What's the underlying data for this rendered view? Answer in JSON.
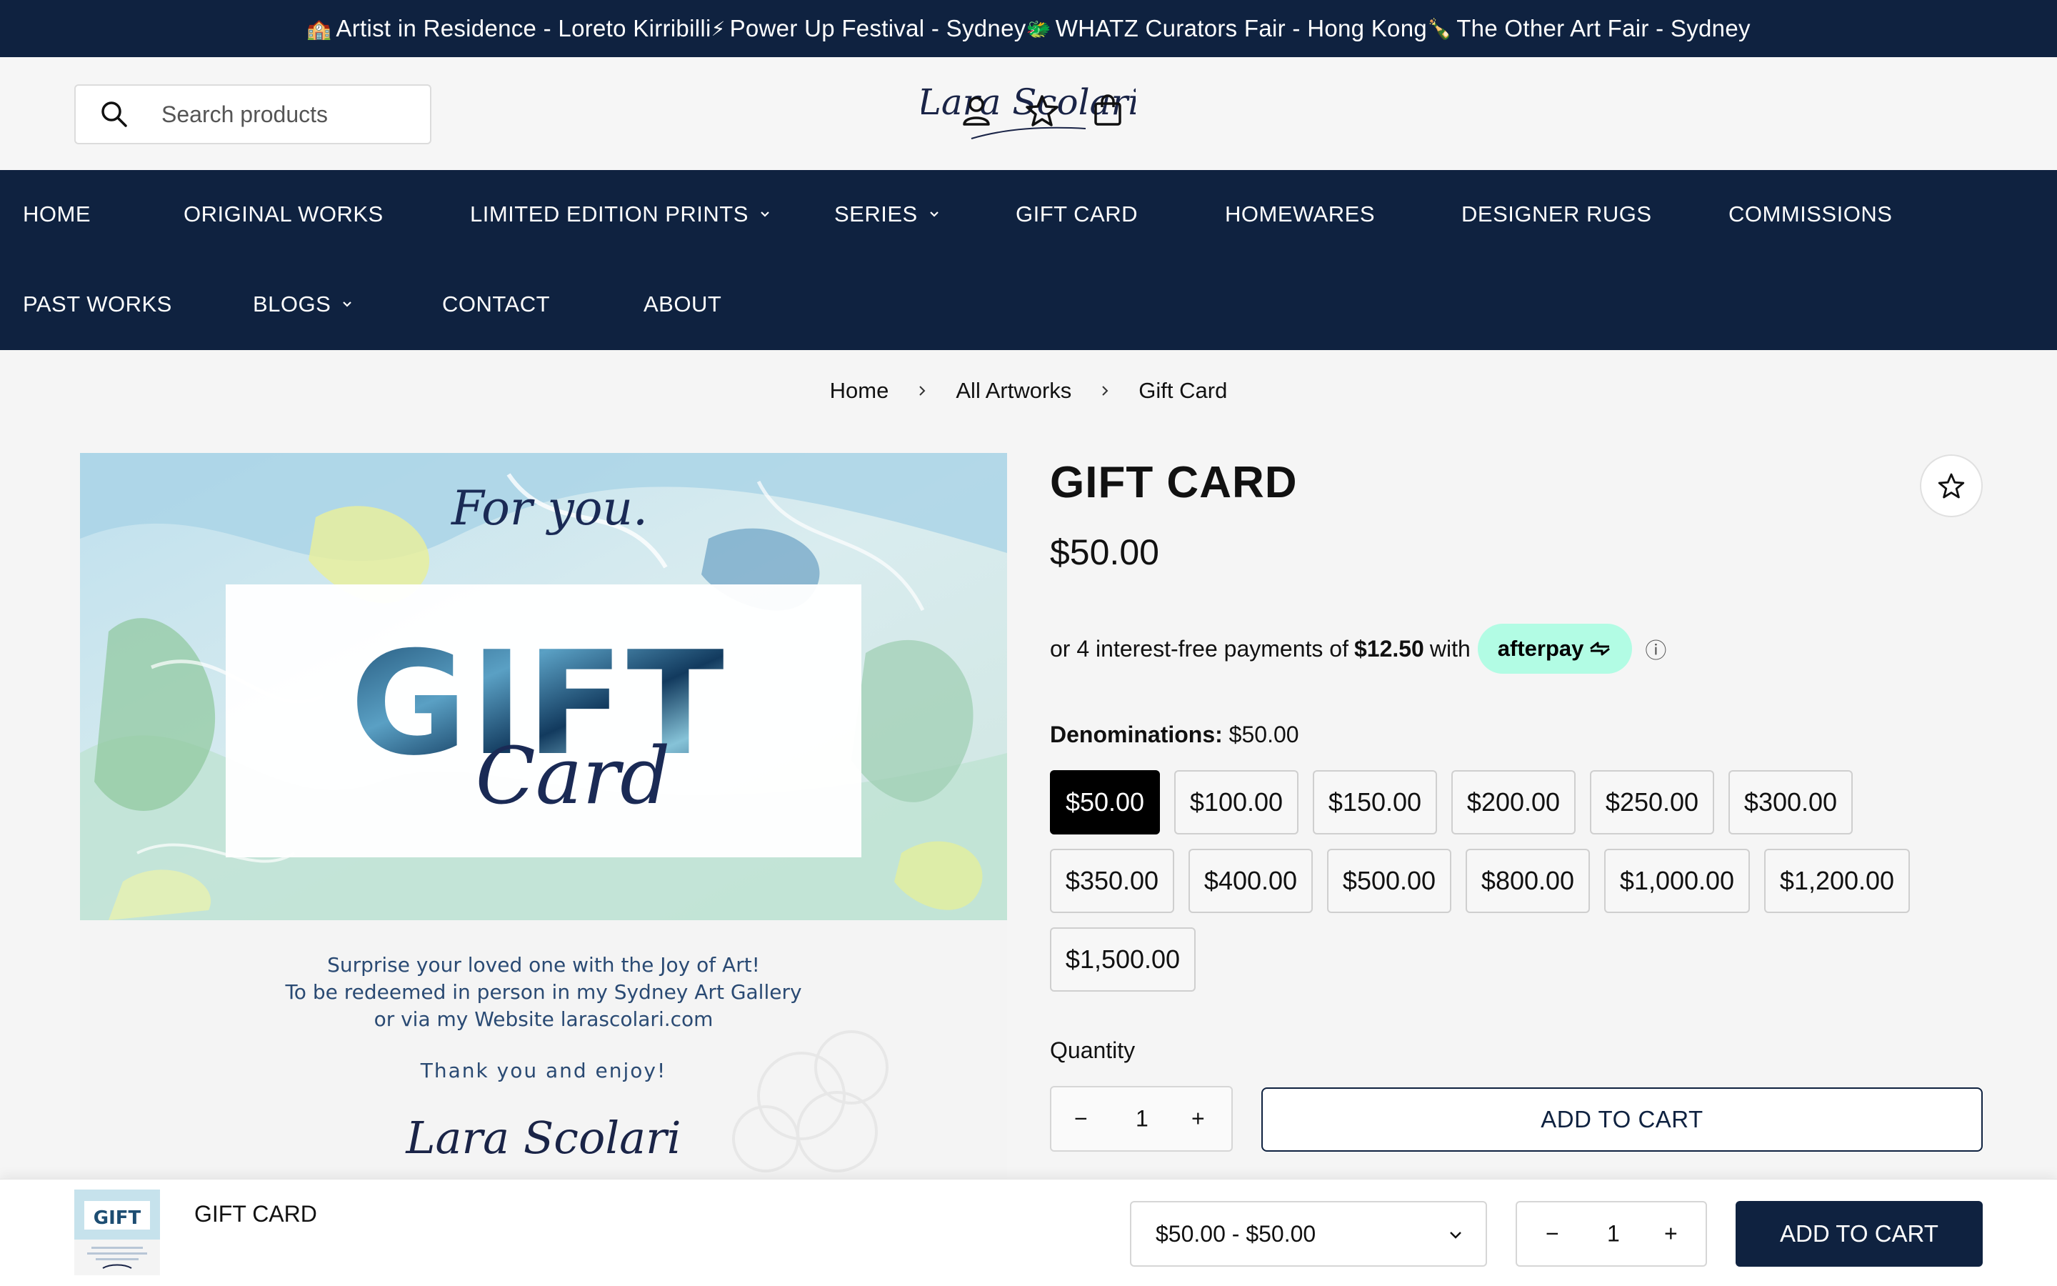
{
  "announcement": {
    "items": [
      {
        "emoji": "🏫",
        "text": "Artist in Residence - Loreto Kirribilli"
      },
      {
        "emoji": "⚡",
        "text": "Power Up Festival - Sydney"
      },
      {
        "emoji": "🐲",
        "text": "WHATZ Curators Fair - Hong Kong"
      },
      {
        "emoji": "🍾",
        "text": "The Other Art Fair - Sydney"
      }
    ]
  },
  "search": {
    "placeholder": "Search products"
  },
  "logo": {
    "text": "Lara Scolari"
  },
  "header_icons": [
    "account-icon",
    "wishlist-icon",
    "cart-icon"
  ],
  "nav": {
    "row1": [
      {
        "label": "HOME"
      },
      {
        "label": "ORIGINAL WORKS"
      },
      {
        "label": "LIMITED EDITION PRINTS",
        "dropdown": true
      },
      {
        "label": "SERIES",
        "dropdown": true
      },
      {
        "label": "GIFT CARD"
      },
      {
        "label": "HOMEWARES"
      },
      {
        "label": "DESIGNER RUGS"
      },
      {
        "label": "COMMISSIONS"
      }
    ],
    "row2": [
      {
        "label": "PAST WORKS"
      },
      {
        "label": "BLOGS",
        "dropdown": true
      },
      {
        "label": "CONTACT"
      },
      {
        "label": "ABOUT"
      }
    ]
  },
  "breadcrumb": [
    "Home",
    "All Artworks",
    "Gift Card"
  ],
  "product_image": {
    "for_you": "For you.",
    "gift": "GIFT",
    "card": "Card",
    "lines": [
      "Surprise your loved one with the Joy of Art!",
      "To be redeemed in person in my Sydney Art Gallery",
      "or via my Website larascolari.com"
    ],
    "thanks": "Thank you and enjoy!",
    "signature": "Lara Scolari"
  },
  "product": {
    "title": "GIFT CARD",
    "price": "$50.00",
    "afterpay": {
      "prefix": "or 4 interest-free payments of",
      "amount": "$12.50",
      "suffix": "with",
      "brand": "afterpay",
      "info_icon": "ⓘ"
    },
    "denomination_label": "Denominations:",
    "denomination_selected": "$50.00",
    "denominations": [
      "$50.00",
      "$100.00",
      "$150.00",
      "$200.00",
      "$250.00",
      "$300.00",
      "$350.00",
      "$400.00",
      "$500.00",
      "$800.00",
      "$1,000.00",
      "$1,200.00",
      "$1,500.00"
    ],
    "quantity_label": "Quantity",
    "quantity": "1",
    "add_to_cart": "ADD TO CART"
  },
  "sticky": {
    "thumb_text": "GIFT",
    "title": "GIFT CARD",
    "variant": "$50.00 - $50.00",
    "quantity": "1",
    "add_to_cart": "ADD TO CART"
  },
  "colors": {
    "navy": "#0f2240",
    "afterpay_mint": "#b2fce4",
    "selected_denomination": "#000000"
  }
}
